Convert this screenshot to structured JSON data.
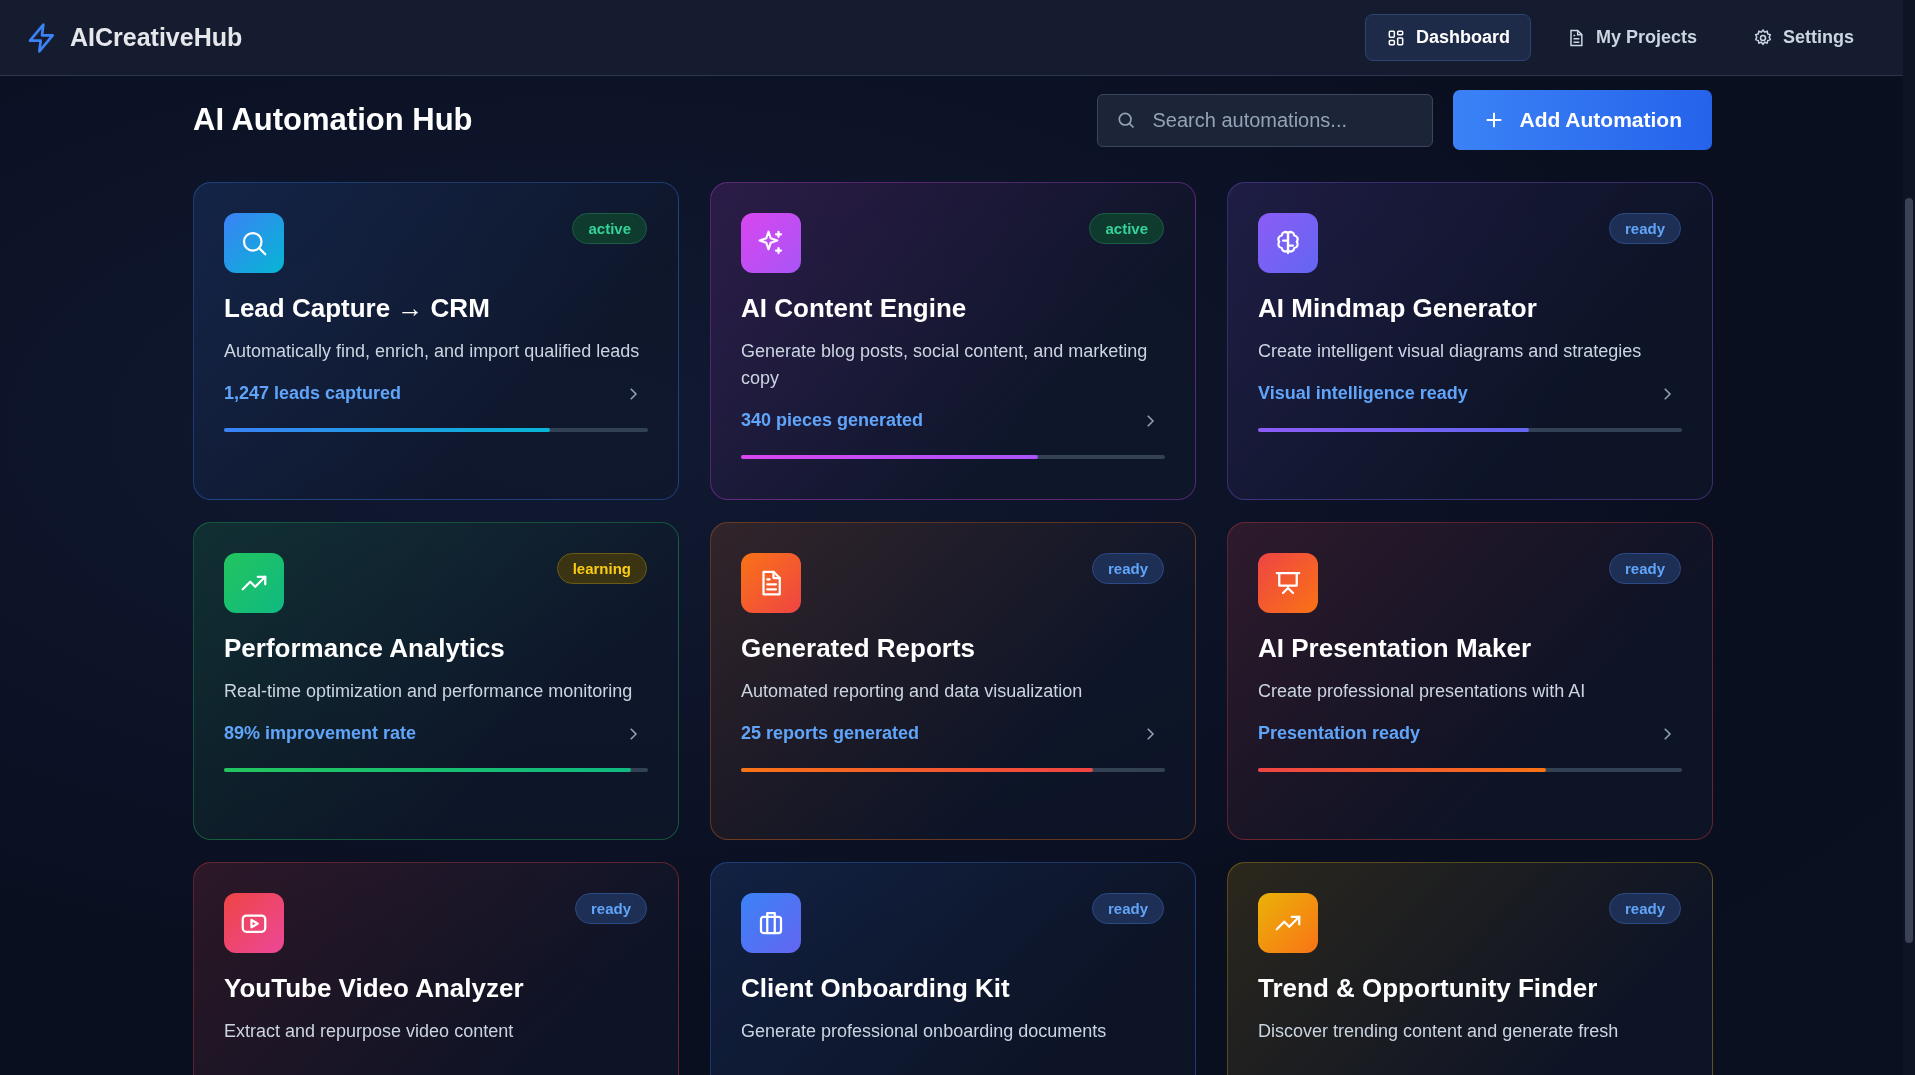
{
  "app": {
    "name": "AICreativeHub"
  },
  "nav": [
    {
      "label": "Dashboard",
      "selected": true
    },
    {
      "label": "My Projects",
      "selected": false
    },
    {
      "label": "Settings",
      "selected": false
    }
  ],
  "page": {
    "title": "AI Automation Hub",
    "search": {
      "placeholder": "Search automations..."
    },
    "add_button": "Add Automation"
  },
  "cards": [
    {
      "title": "Lead Capture → CRM",
      "description": "Automatically find, enrich, and import qualified leads",
      "badge": {
        "label": "active",
        "kind": "success"
      },
      "stat": "1,247 leads captured",
      "level": 0.77,
      "color": "#3b82f6"
    },
    {
      "title": "AI Content Engine",
      "description": "Generate blog posts, social content, and marketing copy",
      "badge": {
        "label": "active",
        "kind": "success"
      },
      "stat": "340 pieces generated",
      "level": 0.7,
      "color": "#d946ef"
    },
    {
      "title": "AI Mindmap Generator",
      "description": "Create intelligent visual diagrams and strategies",
      "badge": {
        "label": "ready",
        "kind": "info"
      },
      "stat": "Visual intelligence ready",
      "level": 0.64,
      "color": "#8b5cf6"
    },
    {
      "title": "Performance Analytics",
      "description": "Real-time optimization and performance monitoring",
      "badge": {
        "label": "learning",
        "kind": "warning"
      },
      "stat": "89% improvement rate",
      "level": 0.96,
      "color": "#22c55e"
    },
    {
      "title": "Generated Reports",
      "description": "Automated reporting and data visualization",
      "badge": {
        "label": "ready",
        "kind": "info"
      },
      "stat": "25 reports generated",
      "level": 0.83,
      "color": "#f97316"
    },
    {
      "title": "AI Presentation Maker",
      "description": "Create professional presentations with AI",
      "badge": {
        "label": "ready",
        "kind": "info"
      },
      "stat": "Presentation ready",
      "level": 0.68,
      "color": "#ef4444"
    },
    {
      "title": "YouTube Video Analyzer",
      "description": "Extract and repurpose video content",
      "badge": {
        "label": "ready",
        "kind": "info"
      },
      "color": "#ef4444"
    },
    {
      "title": "Client Onboarding Kit",
      "description": "Generate professional onboarding documents",
      "badge": {
        "label": "ready",
        "kind": "info"
      },
      "color": "#3b82f6"
    },
    {
      "title": "Trend & Opportunity Finder",
      "description": "Discover trending content and generate fresh",
      "badge": {
        "label": "ready",
        "kind": "info"
      },
      "color": "#eab308"
    }
  ]
}
